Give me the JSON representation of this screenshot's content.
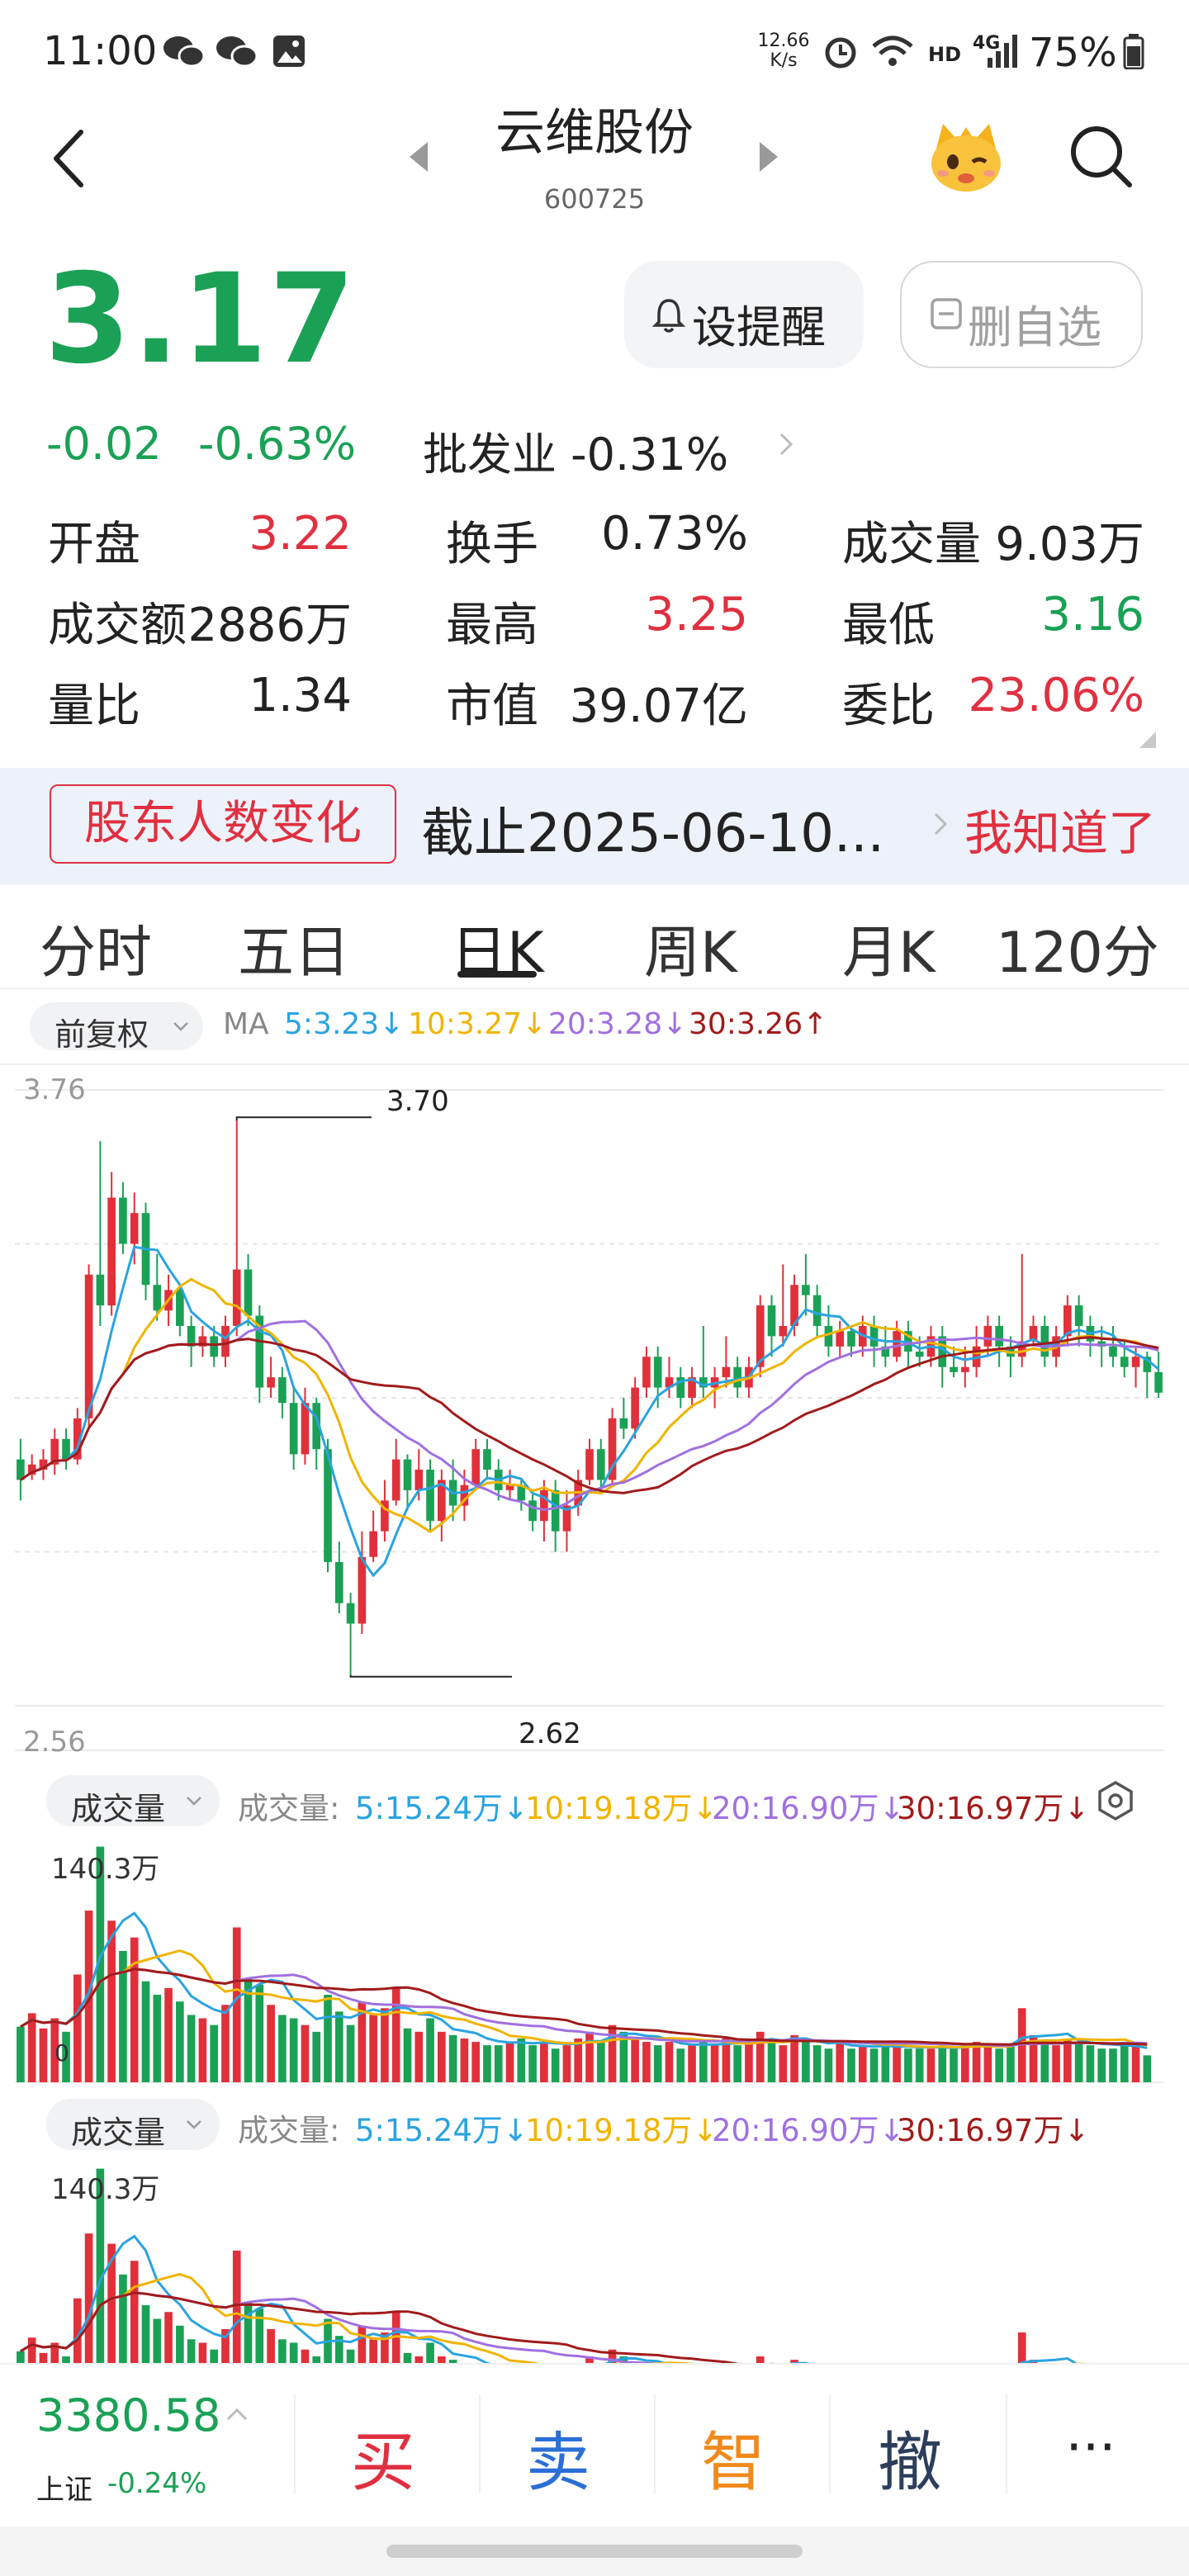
{
  "status_bar": {
    "time": "11:00",
    "net_speed_value": "12.66",
    "net_speed_unit": "K/s",
    "network": "HD",
    "signal": "4G",
    "battery": "75%"
  },
  "header": {
    "stock_name": "云维股份",
    "stock_code": "600725"
  },
  "quote": {
    "price": "3.17",
    "change": "-0.02",
    "change_pct": "-0.63%",
    "industry_label": "批发业 -0.31%",
    "remind_label": "设提醒",
    "remove_label": "删自选"
  },
  "stats": [
    {
      "label": "开盘",
      "value": "3.22",
      "color": "#e03040"
    },
    {
      "label": "换手",
      "value": "0.73%",
      "color": "#222222"
    },
    {
      "label": "成交量",
      "value": "9.03万",
      "color": "#222222"
    },
    {
      "label": "成交额",
      "value": "2886万",
      "color": "#222222"
    },
    {
      "label": "最高",
      "value": "3.25",
      "color": "#e03040"
    },
    {
      "label": "最低",
      "value": "3.16",
      "color": "#1aa155"
    },
    {
      "label": "量比",
      "value": "1.34",
      "color": "#222222"
    },
    {
      "label": "市值",
      "value": "39.07亿",
      "color": "#222222"
    },
    {
      "label": "委比",
      "value": "23.06%",
      "color": "#e03040"
    }
  ],
  "banner": {
    "tag": "股东人数变化",
    "text": "截止2025-06-10...",
    "dismiss": "我知道了"
  },
  "tabs": [
    {
      "label": "分时"
    },
    {
      "label": "五日"
    },
    {
      "label": "日K"
    },
    {
      "label": "周K"
    },
    {
      "label": "月K"
    },
    {
      "label": "120分"
    }
  ],
  "kline": {
    "adjust_label": "前复权",
    "ma_prefix": "MA",
    "ma_items": [
      {
        "text": "5:3.23↓",
        "color": "#2aa3e0"
      },
      {
        "text": "10:3.27↓",
        "color": "#f0b400"
      },
      {
        "text": "20:3.28↓",
        "color": "#a070e0"
      },
      {
        "text": "30:3.26↑",
        "color": "#a11b1b"
      }
    ],
    "y_max_label": "3.76",
    "y_min_label": "2.56",
    "high_marker": "3.70",
    "low_marker": "2.62"
  },
  "volume_panels": [
    {
      "selector": "成交量",
      "prefix": "成交量:",
      "items": [
        {
          "text": "5:15.24万↓",
          "color": "#2aa3e0"
        },
        {
          "text": "10:19.18万↓",
          "color": "#f0b400"
        },
        {
          "text": "20:16.90万↓",
          "color": "#a070e0"
        },
        {
          "text": "30:16.97万↓",
          "color": "#a11b1b"
        }
      ],
      "max_label": "140.3万",
      "zero_label": "0"
    },
    {
      "selector": "成交量",
      "prefix": "成交量:",
      "items": [
        {
          "text": "5:15.24万↓",
          "color": "#2aa3e0"
        },
        {
          "text": "10:19.18万↓",
          "color": "#f0b400"
        },
        {
          "text": "20:16.90万↓",
          "color": "#a070e0"
        },
        {
          "text": "30:16.97万↓",
          "color": "#a11b1b"
        }
      ],
      "max_label": "140.3万"
    }
  ],
  "bottom_bar": {
    "index_value": "3380.58",
    "index_name": "上证",
    "index_change": "-0.24%",
    "actions": [
      {
        "label": "买",
        "color": "#e03040"
      },
      {
        "label": "卖",
        "color": "#2a6fd6"
      },
      {
        "label": "智",
        "color": "#f08a1c"
      },
      {
        "label": "撤",
        "color": "#2c3e5c"
      },
      {
        "label": "···",
        "color": "#222222"
      }
    ]
  },
  "chart_data": {
    "type": "candlestick",
    "y_range": [
      2.56,
      3.76
    ],
    "high": 3.7,
    "low": 2.62,
    "candles": [
      [
        3.04,
        3.0,
        3.08,
        2.96
      ],
      [
        3.01,
        3.03,
        3.05,
        3.0
      ],
      [
        3.02,
        3.04,
        3.06,
        3.0
      ],
      [
        3.03,
        3.08,
        3.1,
        3.01
      ],
      [
        3.08,
        3.04,
        3.1,
        3.02
      ],
      [
        3.04,
        3.12,
        3.14,
        3.03
      ],
      [
        3.12,
        3.4,
        3.42,
        3.1
      ],
      [
        3.4,
        3.34,
        3.66,
        3.3
      ],
      [
        3.34,
        3.55,
        3.6,
        3.32
      ],
      [
        3.55,
        3.46,
        3.58,
        3.44
      ],
      [
        3.46,
        3.52,
        3.56,
        3.42
      ],
      [
        3.52,
        3.38,
        3.54,
        3.35
      ],
      [
        3.38,
        3.33,
        3.44,
        3.31
      ],
      [
        3.33,
        3.37,
        3.4,
        3.3
      ],
      [
        3.37,
        3.3,
        3.38,
        3.28
      ],
      [
        3.3,
        3.26,
        3.32,
        3.22
      ],
      [
        3.26,
        3.28,
        3.3,
        3.24
      ],
      [
        3.28,
        3.24,
        3.3,
        3.22
      ],
      [
        3.24,
        3.3,
        3.32,
        3.22
      ],
      [
        3.3,
        3.41,
        3.7,
        3.28
      ],
      [
        3.41,
        3.32,
        3.44,
        3.3
      ],
      [
        3.32,
        3.18,
        3.34,
        3.15
      ],
      [
        3.18,
        3.2,
        3.24,
        3.16
      ],
      [
        3.2,
        3.15,
        3.22,
        3.12
      ],
      [
        3.15,
        3.05,
        3.18,
        3.02
      ],
      [
        3.05,
        3.15,
        3.18,
        3.03
      ],
      [
        3.15,
        3.06,
        3.16,
        3.02
      ],
      [
        3.06,
        2.84,
        3.08,
        2.82
      ],
      [
        2.84,
        2.76,
        2.88,
        2.74
      ],
      [
        2.76,
        2.72,
        2.78,
        2.62
      ],
      [
        2.72,
        2.85,
        2.9,
        2.7
      ],
      [
        2.85,
        2.9,
        2.94,
        2.84
      ],
      [
        2.9,
        2.96,
        3.0,
        2.88
      ],
      [
        2.96,
        3.04,
        3.08,
        2.95
      ],
      [
        3.04,
        2.98,
        3.05,
        2.94
      ],
      [
        2.98,
        3.02,
        3.06,
        2.96
      ],
      [
        3.02,
        2.92,
        3.04,
        2.9
      ],
      [
        2.92,
        3.0,
        3.02,
        2.88
      ],
      [
        3.0,
        2.95,
        3.04,
        2.92
      ],
      [
        2.95,
        2.99,
        3.02,
        2.92
      ],
      [
        2.99,
        3.06,
        3.08,
        2.98
      ],
      [
        3.06,
        3.02,
        3.08,
        3.0
      ],
      [
        3.02,
        2.98,
        3.04,
        2.96
      ],
      [
        2.98,
        2.99,
        3.02,
        2.96
      ],
      [
        2.99,
        2.96,
        3.0,
        2.94
      ],
      [
        2.96,
        2.92,
        2.98,
        2.9
      ],
      [
        2.92,
        2.98,
        3.0,
        2.88
      ],
      [
        2.98,
        2.9,
        3.0,
        2.86
      ],
      [
        2.9,
        2.95,
        2.98,
        2.86
      ],
      [
        2.95,
        3.0,
        3.02,
        2.93
      ],
      [
        3.0,
        3.06,
        3.08,
        2.99
      ],
      [
        3.06,
        3.0,
        3.08,
        2.98
      ],
      [
        3.0,
        3.12,
        3.14,
        2.99
      ],
      [
        3.12,
        3.1,
        3.16,
        3.08
      ],
      [
        3.1,
        3.18,
        3.2,
        3.08
      ],
      [
        3.18,
        3.24,
        3.26,
        3.16
      ],
      [
        3.24,
        3.18,
        3.26,
        3.14
      ],
      [
        3.18,
        3.2,
        3.24,
        3.16
      ],
      [
        3.2,
        3.16,
        3.22,
        3.14
      ],
      [
        3.16,
        3.2,
        3.22,
        3.14
      ],
      [
        3.2,
        3.18,
        3.3,
        3.16
      ],
      [
        3.18,
        3.2,
        3.22,
        3.14
      ],
      [
        3.2,
        3.22,
        3.28,
        3.18
      ],
      [
        3.22,
        3.18,
        3.24,
        3.16
      ],
      [
        3.18,
        3.22,
        3.24,
        3.16
      ],
      [
        3.22,
        3.34,
        3.36,
        3.2
      ],
      [
        3.34,
        3.28,
        3.36,
        3.24
      ],
      [
        3.28,
        3.3,
        3.42,
        3.26
      ],
      [
        3.3,
        3.38,
        3.4,
        3.28
      ],
      [
        3.38,
        3.36,
        3.44,
        3.32
      ],
      [
        3.36,
        3.3,
        3.38,
        3.28
      ],
      [
        3.3,
        3.26,
        3.34,
        3.24
      ],
      [
        3.26,
        3.29,
        3.31,
        3.24
      ],
      [
        3.29,
        3.26,
        3.3,
        3.24
      ],
      [
        3.26,
        3.3,
        3.32,
        3.24
      ],
      [
        3.3,
        3.26,
        3.32,
        3.22
      ],
      [
        3.26,
        3.24,
        3.3,
        3.22
      ],
      [
        3.24,
        3.29,
        3.31,
        3.23
      ],
      [
        3.29,
        3.25,
        3.31,
        3.22
      ],
      [
        3.25,
        3.24,
        3.28,
        3.22
      ],
      [
        3.24,
        3.28,
        3.3,
        3.22
      ],
      [
        3.28,
        3.22,
        3.3,
        3.18
      ],
      [
        3.22,
        3.21,
        3.26,
        3.2
      ],
      [
        3.21,
        3.22,
        3.26,
        3.18
      ],
      [
        3.22,
        3.26,
        3.3,
        3.2
      ],
      [
        3.26,
        3.3,
        3.32,
        3.24
      ],
      [
        3.3,
        3.26,
        3.32,
        3.22
      ],
      [
        3.26,
        3.24,
        3.28,
        3.2
      ],
      [
        3.24,
        3.27,
        3.44,
        3.22
      ],
      [
        3.27,
        3.3,
        3.32,
        3.26
      ],
      [
        3.3,
        3.24,
        3.32,
        3.22
      ],
      [
        3.24,
        3.28,
        3.3,
        3.22
      ],
      [
        3.28,
        3.34,
        3.36,
        3.26
      ],
      [
        3.34,
        3.3,
        3.36,
        3.26
      ],
      [
        3.3,
        3.27,
        3.32,
        3.24
      ],
      [
        3.27,
        3.26,
        3.3,
        3.22
      ],
      [
        3.26,
        3.24,
        3.3,
        3.22
      ],
      [
        3.24,
        3.22,
        3.27,
        3.2
      ],
      [
        3.22,
        3.24,
        3.26,
        3.18
      ],
      [
        3.24,
        3.21,
        3.25,
        3.16
      ],
      [
        3.21,
        3.17,
        3.25,
        3.16
      ]
    ],
    "volume": [
      33,
      41,
      32,
      38,
      30,
      64,
      102,
      140,
      96,
      78,
      86,
      60,
      52,
      56,
      48,
      40,
      38,
      34,
      46,
      92,
      62,
      58,
      46,
      40,
      38,
      34,
      30,
      52,
      42,
      34,
      48,
      40,
      44,
      56,
      32,
      30,
      38,
      30,
      28,
      26,
      24,
      22,
      22,
      24,
      26,
      22,
      24,
      20,
      22,
      26,
      30,
      24,
      34,
      30,
      26,
      24,
      22,
      24,
      20,
      22,
      24,
      22,
      26,
      22,
      24,
      30,
      26,
      22,
      28,
      24,
      22,
      20,
      24,
      20,
      22,
      20,
      22,
      22,
      20,
      20,
      20,
      22,
      20,
      22,
      24,
      22,
      20,
      22,
      44,
      28,
      24,
      22,
      26,
      24,
      22,
      20,
      20,
      24,
      22,
      16
    ]
  }
}
